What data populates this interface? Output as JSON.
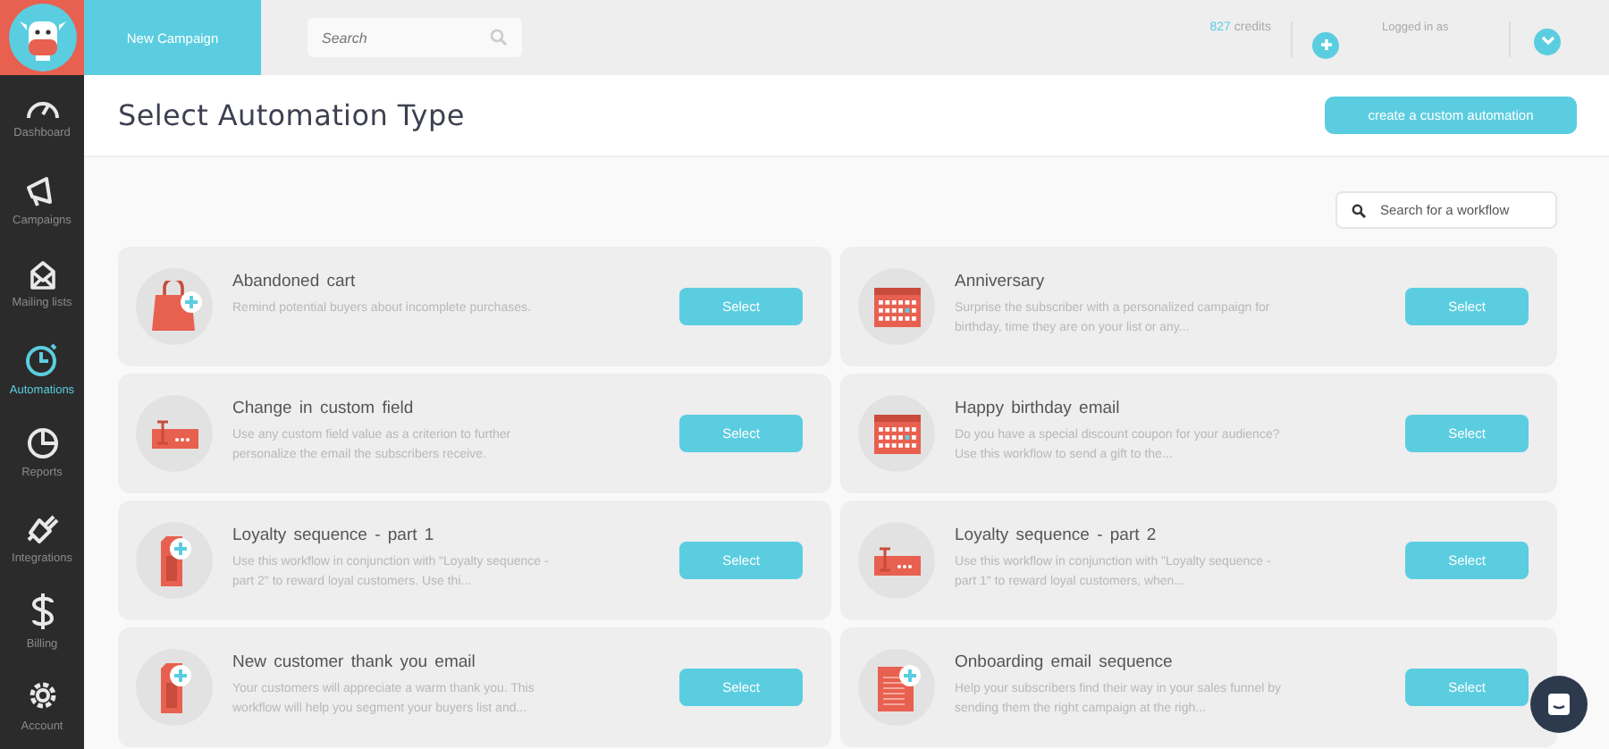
{
  "topbar": {
    "new_campaign": "New Campaign",
    "search": {
      "placeholder": "Search"
    },
    "credits_count": "827",
    "credits_label": "credits",
    "logged_in": "Logged in as"
  },
  "sidebar": {
    "items": [
      {
        "label": "Dashboard",
        "kind": "gauge",
        "selected": false
      },
      {
        "label": "Campaigns",
        "kind": "megaphone",
        "selected": false
      },
      {
        "label": "Mailing lists",
        "kind": "envelope",
        "selected": false
      },
      {
        "label": "Automations",
        "kind": "clock",
        "selected": true
      },
      {
        "label": "Reports",
        "kind": "pie",
        "selected": false
      },
      {
        "label": "Integrations",
        "kind": "plug",
        "selected": false
      },
      {
        "label": "Billing",
        "kind": "dollar",
        "selected": false
      },
      {
        "label": "Account",
        "kind": "gear",
        "selected": false
      }
    ]
  },
  "header": {
    "title": "Select Automation Type",
    "action": "create a custom automation"
  },
  "workflow_search": {
    "placeholder": "Search for a workflow"
  },
  "workflows": [
    {
      "kind": "bag",
      "title": "Abandoned cart",
      "description": "Remind potential buyers about incomplete purchases.",
      "button": "Select"
    },
    {
      "kind": "calendar",
      "title": "Anniversary",
      "description": "Surprise the subscriber with a personalized campaign for birthday, time they are on your list or any...",
      "button": "Select"
    },
    {
      "kind": "field",
      "title": "Change in custom field",
      "description": "Use any custom field value as a criterion to further personalize the email the subscribers receive.",
      "button": "Select"
    },
    {
      "kind": "calendar",
      "title": "Happy birthday email",
      "description": "Do you have a special discount coupon for your audience? Use this workflow to send a gift to the...",
      "button": "Select"
    },
    {
      "kind": "tag",
      "title": "Loyalty sequence - part 1",
      "description": "Use this workflow in conjunction with \"Loyalty sequence - part 2\" to reward loyal customers. Use thi...",
      "button": "Select"
    },
    {
      "kind": "field",
      "title": "Loyalty sequence - part 2",
      "description": "Use this workflow in conjunction with \"Loyalty sequence - part 1\" to reward loyal customers, when...",
      "button": "Select"
    },
    {
      "kind": "tag",
      "title": "New customer thank you email",
      "description": "Your customers will appreciate a warm thank you. This workflow will help you segment your buyers list and...",
      "button": "Select"
    },
    {
      "kind": "list",
      "title": "Onboarding email sequence",
      "description": "Help your subscribers find their way in your sales funnel by sending them the right campaign at the righ...",
      "button": "Select"
    }
  ]
}
